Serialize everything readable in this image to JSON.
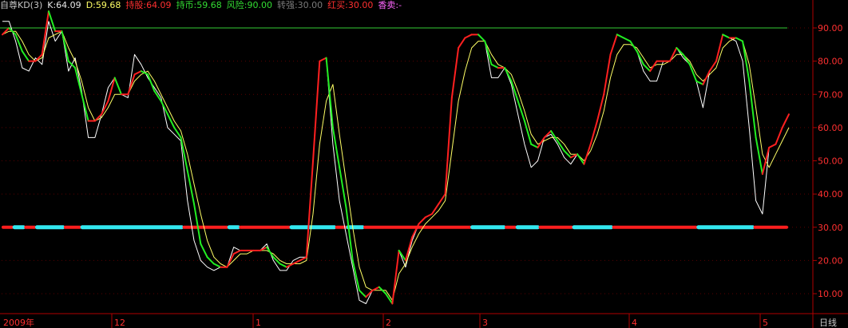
{
  "header": {
    "title": "自尊KD(3)",
    "k": "K:64.09",
    "d": "D:59.68",
    "hold": "持股:64.09",
    "wait": "持币:59.68",
    "risk": "风险:90.00",
    "strong": "转强:30.00",
    "red": "红买:30.00",
    "buysell": "香卖:-"
  },
  "chart_data": {
    "type": "line",
    "ylim": [
      4,
      95
    ],
    "yticks": [
      "90.00",
      "80.00",
      "70.00",
      "60.00",
      "50.00",
      "40.00",
      "30.00",
      "20.00",
      "10.00"
    ],
    "xtick_labels": [
      "2009年",
      "12",
      "1",
      "2",
      "3",
      "4",
      "5"
    ],
    "period_label": "日线",
    "risk_level": 90,
    "strong_level": 30,
    "colors": {
      "k_rise": "#ff2020",
      "k_fall": "#22ee22",
      "d_line": "#ffff66",
      "j_line": "#ffffff",
      "risk_line": "#33cc33",
      "band_red": "#ff1e1e",
      "band_cyan": "#33e8f0",
      "axis": "#b00000",
      "label": "#ff3030"
    },
    "k": [
      88,
      90,
      88,
      83,
      80,
      80,
      82,
      95,
      89,
      89,
      80,
      78,
      70,
      62,
      62,
      64,
      68,
      75,
      70,
      70,
      76,
      77,
      76,
      71,
      68,
      64,
      60,
      57,
      47,
      37,
      25,
      21,
      19,
      18,
      18,
      22,
      23,
      23,
      23,
      23,
      24,
      21,
      19,
      18,
      19,
      20,
      21,
      50,
      80,
      81,
      60,
      48,
      36,
      20,
      11,
      9,
      11,
      12,
      10,
      7,
      23,
      20,
      27,
      31,
      33,
      34,
      37,
      40,
      69,
      84,
      87,
      88,
      88,
      86,
      79,
      78,
      78,
      74,
      68,
      62,
      55,
      54,
      57,
      59,
      56,
      53,
      51,
      52,
      49,
      55,
      62,
      70,
      82,
      88,
      87,
      86,
      83,
      79,
      77,
      80,
      80,
      80,
      84,
      82,
      79,
      74,
      73,
      77,
      80,
      88,
      87,
      87,
      86,
      74,
      57,
      46,
      54,
      55,
      60,
      64
    ],
    "d": [
      88,
      89,
      89,
      86,
      82,
      80,
      81,
      87,
      88,
      89,
      84,
      80,
      74,
      66,
      62,
      63,
      66,
      70,
      70,
      70,
      74,
      76,
      77,
      74,
      70,
      66,
      62,
      59,
      52,
      43,
      34,
      26,
      21,
      19,
      18,
      20,
      22,
      22,
      23,
      23,
      23,
      22,
      20,
      19,
      19,
      19,
      20,
      34,
      55,
      68,
      73,
      58,
      44,
      30,
      18,
      12,
      11,
      11,
      11,
      8,
      16,
      19,
      24,
      28,
      31,
      33,
      35,
      38,
      53,
      68,
      77,
      84,
      86,
      86,
      82,
      79,
      78,
      76,
      71,
      65,
      58,
      55,
      56,
      57,
      57,
      55,
      52,
      52,
      50,
      53,
      58,
      65,
      75,
      82,
      85,
      85,
      84,
      81,
      78,
      79,
      79,
      80,
      82,
      82,
      80,
      76,
      74,
      76,
      78,
      84,
      86,
      87,
      86,
      79,
      66,
      52,
      48,
      52,
      56,
      60
    ],
    "j": [
      92,
      92,
      86,
      78,
      77,
      81,
      79,
      92,
      86,
      89,
      77,
      81,
      71,
      57,
      57,
      64,
      72,
      75,
      70,
      69,
      82,
      79,
      75,
      72,
      69,
      60,
      58,
      56,
      38,
      26,
      20,
      18,
      17,
      18,
      18,
      24,
      23,
      23,
      23,
      23,
      25,
      20,
      17,
      17,
      20,
      21,
      21,
      50,
      80,
      81,
      55,
      38,
      28,
      18,
      8,
      7,
      11,
      12,
      10,
      7,
      23,
      18,
      26,
      31,
      33,
      34,
      37,
      40,
      69,
      84,
      87,
      88,
      88,
      86,
      75,
      75,
      78,
      73,
      64,
      55,
      48,
      50,
      57,
      58,
      55,
      51,
      49,
      52,
      49,
      55,
      62,
      70,
      82,
      88,
      87,
      86,
      83,
      77,
      74,
      74,
      80,
      80,
      84,
      81,
      79,
      74,
      66,
      77,
      80,
      88,
      87,
      86,
      80,
      60,
      38,
      34,
      54,
      55,
      60,
      64
    ],
    "band_pattern": "rrccrrcccccrrrccccccccccccccccccrrrrrrrrccrrrrrrrrrccccccccrrcccrrrrrrrrrrrrrrrrrrrccccccrrccccrrrrrrcccccccrrrrrrrrrrrrrrrccccccccccrrrrrr"
  }
}
